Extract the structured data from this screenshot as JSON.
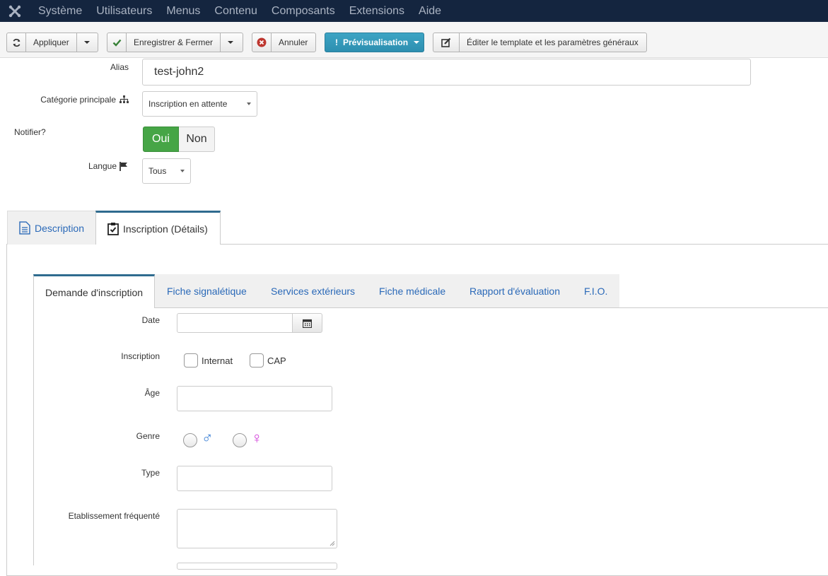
{
  "nav": {
    "items": [
      "Système",
      "Utilisateurs",
      "Menus",
      "Contenu",
      "Composants",
      "Extensions",
      "Aide"
    ]
  },
  "toolbar": {
    "apply_label": "Appliquer",
    "save_close_label": "Enregistrer & Fermer",
    "cancel_label": "Annuler",
    "preview_label": "Prévisualisation",
    "edit_template_label": "Éditer le template et les paramètres généraux"
  },
  "form": {
    "alias_label": "Alias",
    "alias_value": "test-john2",
    "category_label": "Catégorie principale",
    "category_value": "Inscription en attente",
    "notify_label": "Notifier?",
    "notify_yes": "Oui",
    "notify_no": "Non",
    "language_label": "Langue",
    "language_value": "Tous"
  },
  "main_tabs": [
    {
      "label": "Description",
      "active": false
    },
    {
      "label": "Inscription (Détails)",
      "active": true
    }
  ],
  "sub_tabs": [
    {
      "label": "Demande d'inscription",
      "active": true
    },
    {
      "label": "Fiche signalétique",
      "active": false
    },
    {
      "label": "Services extérieurs",
      "active": false
    },
    {
      "label": "Fiche médicale",
      "active": false
    },
    {
      "label": "Rapport d'évaluation",
      "active": false
    },
    {
      "label": "F.I.O.",
      "active": false
    }
  ],
  "details": {
    "date_label": "Date",
    "inscription_label": "Inscription",
    "internat_label": "Internat",
    "cap_label": "CAP",
    "age_label": "Âge",
    "genre_label": "Genre",
    "male_symbol": "♂",
    "female_symbol": "♀",
    "type_label": "Type",
    "etablissement_label": "Etablissement fréquenté"
  },
  "colors": {
    "nav_bg": "#14253f",
    "nav_text": "#aab3c2",
    "preview_bg": "#2d8fb0",
    "toggle_on": "#46a546",
    "link": "#2a69b8",
    "male": "#3a7fd5",
    "female": "#d03ad8"
  }
}
